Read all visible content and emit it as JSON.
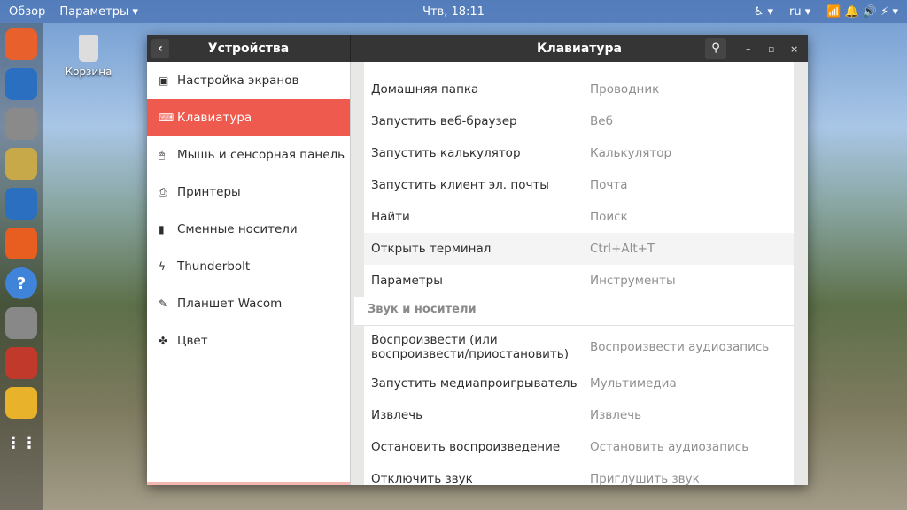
{
  "topbar": {
    "overview": "Обзор",
    "app_menu": "Параметры ▾",
    "clock": "Чтв, 18:11",
    "lang": "ru ▾"
  },
  "desktop": {
    "trash_label": "Корзина"
  },
  "window": {
    "sidebar_title": "Устройства",
    "title": "Клавиатура"
  },
  "sidebar": {
    "items": [
      {
        "label": "Настройка экранов",
        "icon": "display-icon",
        "glyph": "▣"
      },
      {
        "label": "Клавиатура",
        "icon": "keyboard-icon",
        "glyph": "⌨",
        "selected": true
      },
      {
        "label": "Мышь и сенсорная панель",
        "icon": "mouse-icon",
        "glyph": "🖱"
      },
      {
        "label": "Принтеры",
        "icon": "printer-icon",
        "glyph": "⎙"
      },
      {
        "label": "Сменные носители",
        "icon": "usb-icon",
        "glyph": "▮"
      },
      {
        "label": "Thunderbolt",
        "icon": "thunderbolt-icon",
        "glyph": "ϟ"
      },
      {
        "label": "Планшет Wacom",
        "icon": "tablet-icon",
        "glyph": "✎"
      },
      {
        "label": "Цвет",
        "icon": "color-icon",
        "glyph": "✤"
      }
    ]
  },
  "shortcuts": {
    "launchers": [
      {
        "name": "Домашняя папка",
        "value": "Проводник"
      },
      {
        "name": "Запустить веб-браузер",
        "value": "Веб"
      },
      {
        "name": "Запустить калькулятор",
        "value": "Калькулятор"
      },
      {
        "name": "Запустить клиент эл. почты",
        "value": "Почта"
      },
      {
        "name": "Найти",
        "value": "Поиск"
      },
      {
        "name": "Открыть терминал",
        "value": "Ctrl+Alt+T"
      },
      {
        "name": "Параметры",
        "value": "Инструменты"
      }
    ],
    "sound_section": "Звук и носители",
    "sound": [
      {
        "name": "Воспроизвести (или воспроизвести/приостановить)",
        "value": "Воспроизвести аудиозапись"
      },
      {
        "name": "Запустить медиапроигрыватель",
        "value": "Мультимедиа"
      },
      {
        "name": "Извлечь",
        "value": "Извлечь"
      },
      {
        "name": "Остановить воспроизведение",
        "value": "Остановить аудиозапись"
      },
      {
        "name": "Отключить звук",
        "value": "Приглушить звук"
      }
    ]
  },
  "colors": {
    "accent": "#ef5a4e",
    "header": "#353535"
  },
  "dock": [
    "firefox-icon",
    "thunderbird-icon",
    "files-icon",
    "rhythmbox-icon",
    "writer-icon",
    "software-icon",
    "help-icon",
    "sound-recorder-icon",
    "settings-icon",
    "chrome-icon",
    "apps-grid-icon"
  ]
}
